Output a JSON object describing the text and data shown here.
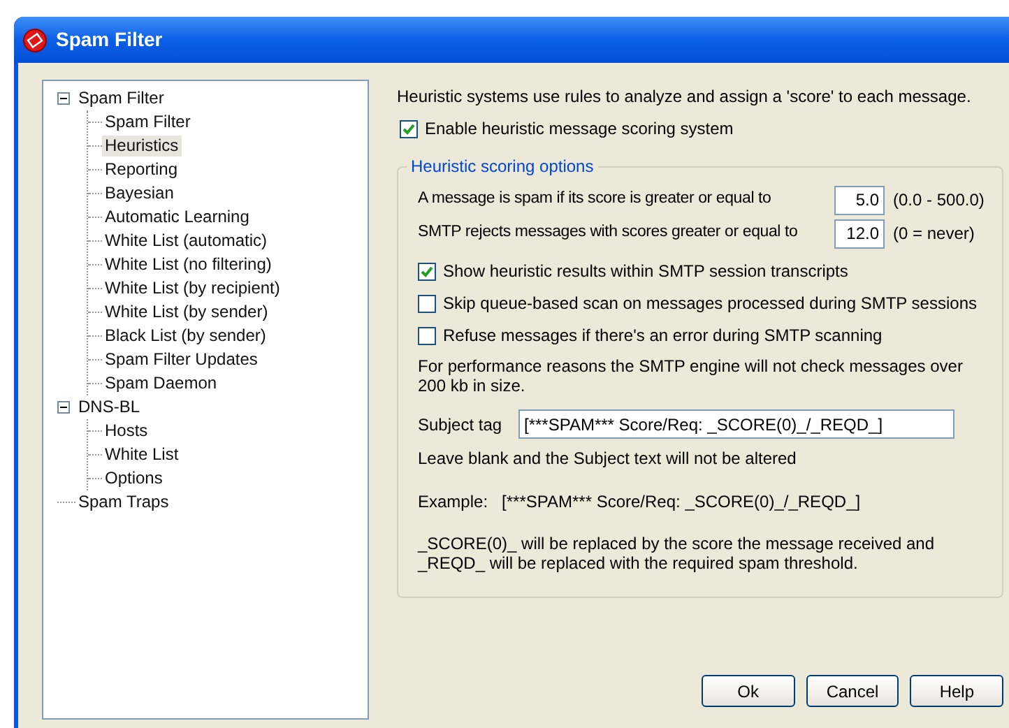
{
  "window": {
    "title": "Spam Filter"
  },
  "tree": [
    {
      "label": "Spam Filter",
      "selected": false,
      "expanded": true,
      "children": [
        {
          "label": "Spam Filter",
          "selected": false
        },
        {
          "label": "Heuristics",
          "selected": true
        },
        {
          "label": "Reporting",
          "selected": false
        },
        {
          "label": "Bayesian",
          "selected": false
        },
        {
          "label": "Automatic Learning",
          "selected": false
        },
        {
          "label": "White List (automatic)",
          "selected": false
        },
        {
          "label": "White List (no filtering)",
          "selected": false
        },
        {
          "label": "White List (by recipient)",
          "selected": false
        },
        {
          "label": "White List (by sender)",
          "selected": false
        },
        {
          "label": "Black List (by sender)",
          "selected": false
        },
        {
          "label": "Spam Filter Updates",
          "selected": false
        },
        {
          "label": "Spam Daemon",
          "selected": false
        }
      ]
    },
    {
      "label": "DNS-BL",
      "selected": false,
      "expanded": true,
      "children": [
        {
          "label": "Hosts",
          "selected": false
        },
        {
          "label": "White List",
          "selected": false
        },
        {
          "label": "Options",
          "selected": false
        }
      ]
    },
    {
      "label": "Spam Traps",
      "selected": false
    }
  ],
  "intro": "Heuristic systems use rules to analyze and assign a 'score' to each message.",
  "enable": {
    "label": "Enable heuristic message scoring system",
    "checked": true
  },
  "group": {
    "title": "Heuristic scoring options",
    "thresholds": [
      {
        "label": "A message is spam if its score is greater or equal to",
        "value": "5.0",
        "hint": "(0.0 - 500.0)"
      },
      {
        "label": "SMTP rejects messages with scores greater or equal to",
        "value": "12.0",
        "hint": "(0 = never)"
      }
    ],
    "options": [
      {
        "label": "Show heuristic results within SMTP session transcripts",
        "checked": true
      },
      {
        "label": "Skip queue-based scan on messages processed during SMTP sessions",
        "checked": false
      },
      {
        "label": "Refuse messages if there's an error during SMTP scanning",
        "checked": false
      }
    ],
    "note": "For performance reasons the SMTP engine will not check messages over 200 kb in size.",
    "subject_tag": {
      "label": "Subject tag",
      "value": "[***SPAM*** Score/Req: _SCORE(0)_/_REQD_]"
    },
    "blank_note": "Leave blank and the Subject text will not be altered",
    "example_label": "Example:",
    "example_value": "[***SPAM*** Score/Req: _SCORE(0)_/_REQD_]",
    "explanation": "_SCORE(0)_ will be replaced by the score the message received and _REQD_ will be replaced with the required spam threshold."
  },
  "buttons": [
    "Ok",
    "Cancel",
    "Help"
  ]
}
